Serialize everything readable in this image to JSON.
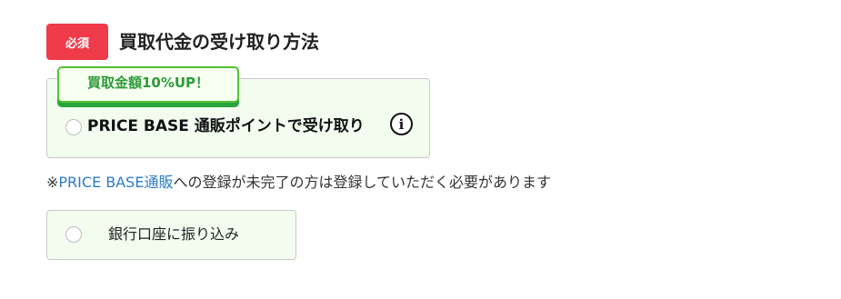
{
  "section": {
    "required_label": "必須",
    "title": "買取代金の受け取り方法"
  },
  "options": {
    "points": {
      "bonus_tag": "買取金額10%UP！",
      "label": "PRICE BASE 通販ポイントで受け取り",
      "info_icon_glyph": "i",
      "selected": false
    },
    "bank": {
      "label": "銀行口座に振り込み",
      "selected": false
    }
  },
  "note": {
    "prefix": "※",
    "link_text": "PRICE BASE通販",
    "suffix": "への登録が未完了の方は登録していただく必要があります"
  },
  "colors": {
    "required_badge": "#ef3b4a",
    "option_background": "#f2fdf0",
    "bonus_tag_text": "#2e9a3a",
    "bonus_tag_border": "#52c234",
    "link": "#2b7bc6"
  }
}
